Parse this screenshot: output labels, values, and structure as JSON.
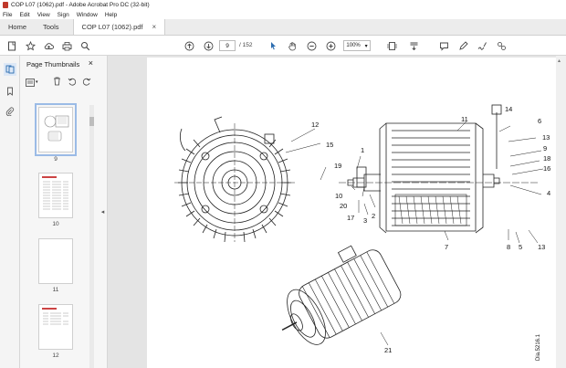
{
  "window": {
    "title": "COP L07 (1062).pdf - Adobe Acrobat Pro DC (32-bit)"
  },
  "menu": [
    "File",
    "Edit",
    "View",
    "Sign",
    "Window",
    "Help"
  ],
  "tabs": {
    "home": "Home",
    "tools": "Tools",
    "document": "COP L07 (1062).pdf"
  },
  "toolbar": {
    "current_page": "9",
    "page_total": "/ 152",
    "zoom": "100%"
  },
  "thumbnails": {
    "title": "Page Thumbnails",
    "pages": [
      "9",
      "10",
      "11",
      "12"
    ]
  },
  "drawing": {
    "callouts": [
      "1",
      "2",
      "3",
      "4",
      "5",
      "6",
      "7",
      "8",
      "9",
      "10",
      "11",
      "12",
      "13",
      "13",
      "14",
      "15",
      "16",
      "17",
      "18",
      "19",
      "20",
      "21"
    ],
    "reference": "Dia.5216.1"
  },
  "icons": {
    "home": "home-icon",
    "star": "star-icon",
    "upload": "upload-icon",
    "print": "print-icon",
    "search": "search-icon",
    "prev": "prev-page-icon",
    "next": "next-page-icon"
  },
  "colors": {
    "accent": "#2b6cb0",
    "pdf": "#c0392b"
  }
}
